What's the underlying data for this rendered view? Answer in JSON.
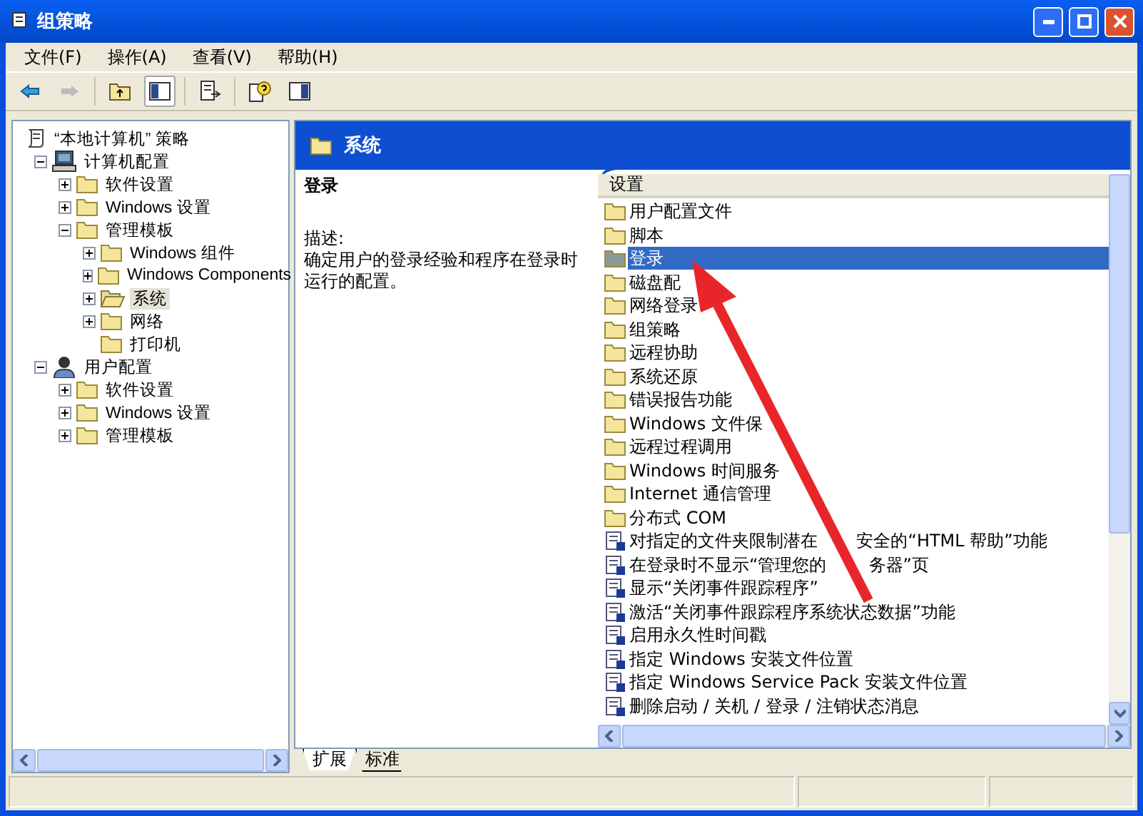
{
  "window": {
    "title": "组策略"
  },
  "menu": [
    {
      "label": "文件(F)"
    },
    {
      "label": "操作(A)"
    },
    {
      "label": "查看(V)"
    },
    {
      "label": "帮助(H)"
    }
  ],
  "tree": [
    {
      "label": "“本地计算机” 策略",
      "kind": "root",
      "selected": false,
      "children": [
        {
          "label": "计算机配置",
          "kind": "computer",
          "expanded": true,
          "selected": false,
          "children": [
            {
              "label": "软件设置",
              "kind": "folder",
              "expanded": false,
              "selected": false
            },
            {
              "label": "Windows 设置",
              "kind": "folder",
              "expanded": false,
              "selected": false
            },
            {
              "label": "管理模板",
              "kind": "folder",
              "expanded": true,
              "selected": false,
              "children": [
                {
                  "label": "Windows 组件",
                  "kind": "folder",
                  "expanded": false,
                  "selected": false
                },
                {
                  "label": "Windows Components",
                  "kind": "folder",
                  "expanded": false,
                  "selected": false
                },
                {
                  "label": "系统",
                  "kind": "folder",
                  "expanded": false,
                  "selected": true
                },
                {
                  "label": "网络",
                  "kind": "folder",
                  "expanded": false,
                  "selected": false
                },
                {
                  "label": "打印机",
                  "kind": "folder",
                  "selected": false
                }
              ]
            }
          ]
        },
        {
          "label": "用户配置",
          "kind": "user",
          "expanded": true,
          "selected": false,
          "children": [
            {
              "label": "软件设置",
              "kind": "folder",
              "expanded": false,
              "selected": false
            },
            {
              "label": "Windows 设置",
              "kind": "folder",
              "expanded": false,
              "selected": false
            },
            {
              "label": "管理模板",
              "kind": "folder",
              "expanded": false,
              "selected": false
            }
          ]
        }
      ]
    }
  ],
  "header": {
    "title": "系统"
  },
  "description": {
    "title": "登录",
    "label": "描述:",
    "text": "确定用户的登录经验和程序在登录时运行的配置。"
  },
  "list": {
    "column": "设置",
    "items": [
      {
        "label": "用户配置文件",
        "kind": "folder",
        "selected": false
      },
      {
        "label": "脚本",
        "kind": "folder",
        "selected": false
      },
      {
        "label": "登录",
        "kind": "folder",
        "selected": true
      },
      {
        "label": "磁盘配",
        "kind": "folder",
        "selected": false
      },
      {
        "label": "网络登录",
        "kind": "folder",
        "selected": false
      },
      {
        "label": "组策略",
        "kind": "folder",
        "selected": false
      },
      {
        "label": "远程协助",
        "kind": "folder",
        "selected": false
      },
      {
        "label": "系统还原",
        "kind": "folder",
        "selected": false
      },
      {
        "label": "错误报告功能",
        "kind": "folder",
        "selected": false
      },
      {
        "label": "Windows 文件保",
        "kind": "folder",
        "selected": false
      },
      {
        "label": "远程过程调用",
        "kind": "folder",
        "selected": false
      },
      {
        "label": "Windows 时间服务",
        "kind": "folder",
        "selected": false
      },
      {
        "label": "Internet 通信管理",
        "kind": "folder",
        "selected": false
      },
      {
        "label": "分布式 COM",
        "kind": "folder",
        "selected": false
      },
      {
        "label": "对指定的文件夹限制潜在",
        "label_after": "安全的“HTML 帮助”功能",
        "kind": "setting",
        "selected": false
      },
      {
        "label": "在登录时不显示“管理您的",
        "label_after": "务器”页",
        "kind": "setting",
        "selected": false
      },
      {
        "label": "显示“关闭事件跟踪程序”",
        "kind": "setting",
        "selected": false
      },
      {
        "label": "激活“关闭事件跟踪程序系统状态数据”功能",
        "kind": "setting",
        "selected": false
      },
      {
        "label": "启用永久性时间戳",
        "kind": "setting",
        "selected": false
      },
      {
        "label": "指定 Windows 安装文件位置",
        "kind": "setting",
        "selected": false
      },
      {
        "label": "指定 Windows Service Pack 安装文件位置",
        "kind": "setting",
        "selected": false
      },
      {
        "label": "删除启动 / 关机 / 登录 / 注销状态消息",
        "kind": "setting",
        "selected": false
      }
    ]
  },
  "tabs": [
    {
      "label": "扩展",
      "selected": true
    },
    {
      "label": "标准",
      "selected": false
    }
  ]
}
